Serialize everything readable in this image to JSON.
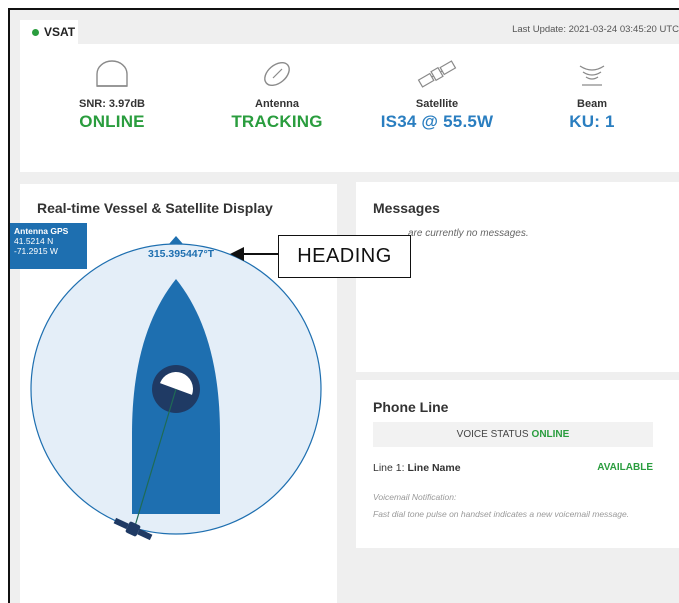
{
  "vsat": {
    "tab_label": "VSAT",
    "status_color": "#2a9d3e",
    "last_update": "Last Update: 2021-03-24 03:45:20 UTC",
    "stats": [
      {
        "icon": "antenna-dome-icon",
        "label": "SNR: 3.97dB",
        "value": "ONLINE",
        "color": "green"
      },
      {
        "icon": "dish-icon",
        "label": "Antenna",
        "value": "TRACKING",
        "color": "green"
      },
      {
        "icon": "satellite-icon",
        "label": "Satellite",
        "value": "IS34 @ 55.5W",
        "color": "blue"
      },
      {
        "icon": "beam-signal-icon",
        "label": "Beam",
        "value": "KU: 1",
        "color": "blue"
      }
    ]
  },
  "vessel": {
    "title": "Real-time Vessel & Satellite Display",
    "gps": {
      "title": "Antenna GPS",
      "lat": "41.5214 N",
      "lon": "-71.2915 W"
    },
    "heading_value": "315.395447°T",
    "callout": "HEADING"
  },
  "messages": {
    "title": "Messages",
    "empty_text": "are currently no messages."
  },
  "phone": {
    "title": "Phone Line",
    "voice_status_label": "VOICE STATUS",
    "voice_status_value": "ONLINE",
    "line_prefix": "Line 1:",
    "line_name": "Line Name",
    "line_status": "AVAILABLE",
    "voicemail_title": "Voicemail Notification:",
    "voicemail_text": "Fast dial tone pulse on handset indicates a new voicemail message."
  },
  "colors": {
    "green": "#2a9d3e",
    "blue": "#2a7ec0",
    "vessel": "#1e6fb0"
  }
}
